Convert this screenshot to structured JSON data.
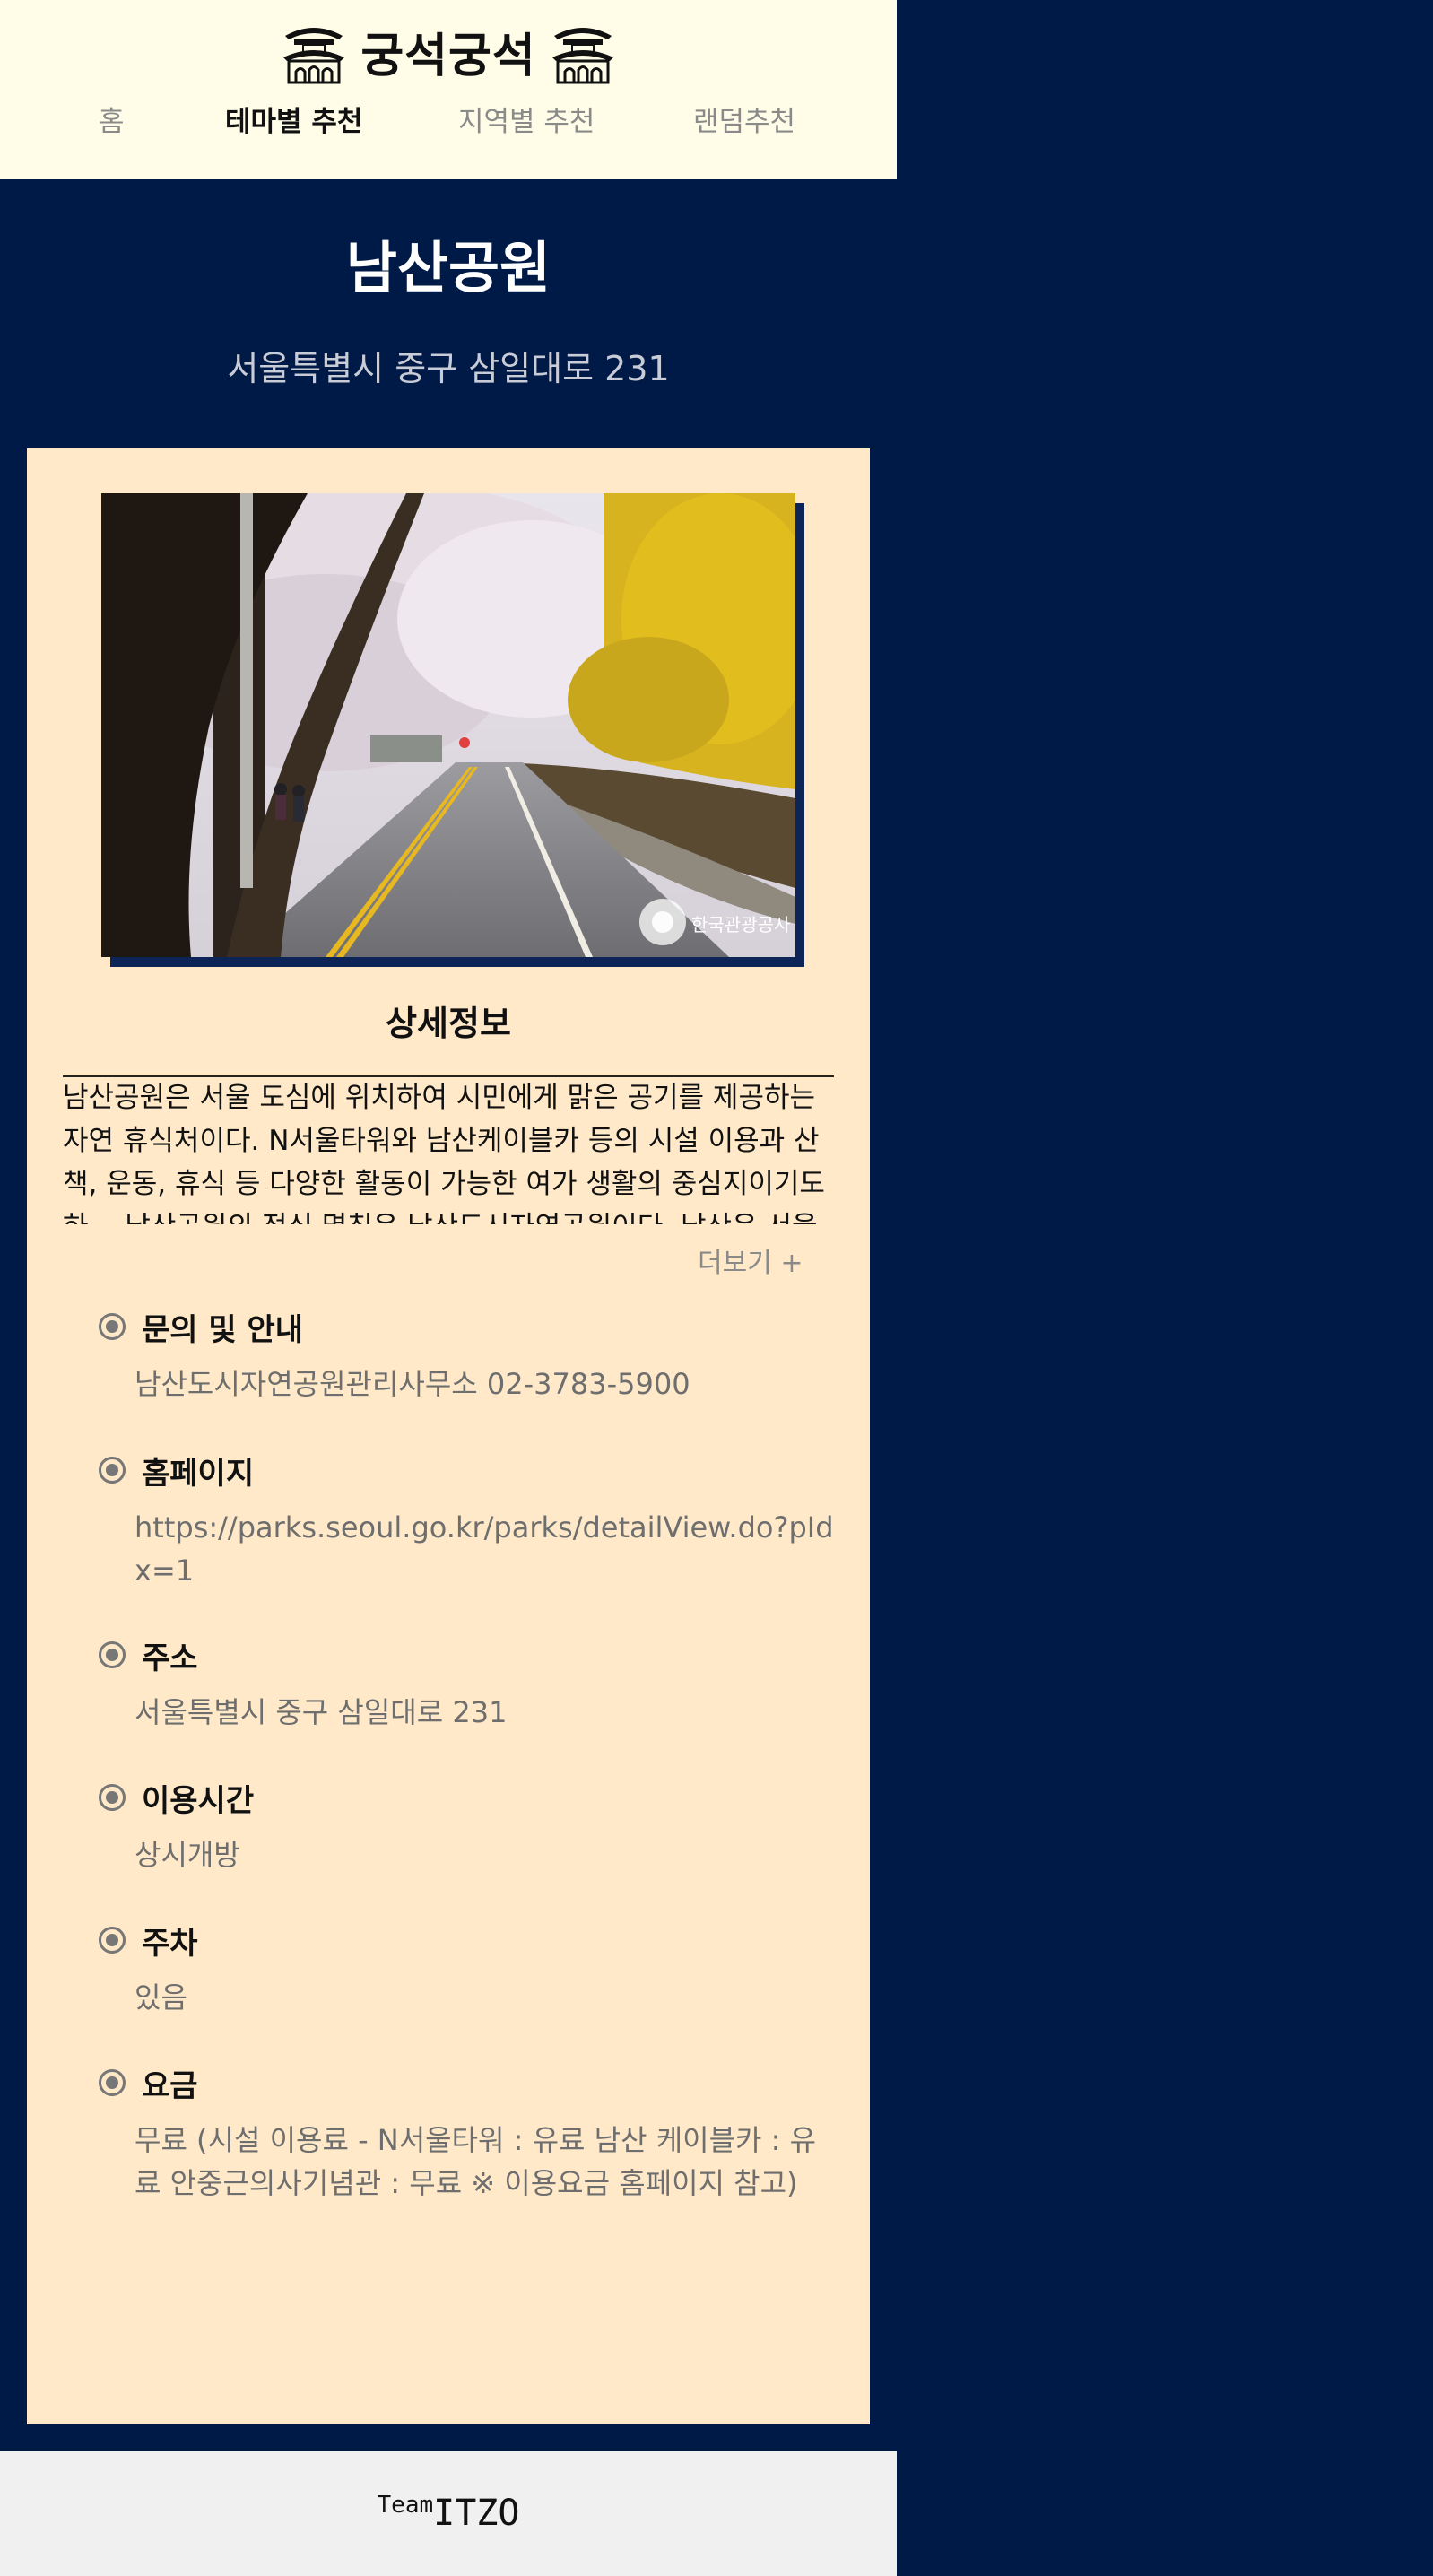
{
  "header": {
    "brand": "궁석궁석",
    "gate_icon": "palace-gate-icon",
    "nav": [
      {
        "label": "홈",
        "active": false
      },
      {
        "label": "테마별 추천",
        "active": true
      },
      {
        "label": "지역별 추천",
        "active": false
      },
      {
        "label": "랜덤추천",
        "active": false
      }
    ]
  },
  "place": {
    "title": "남산공원",
    "address": "서울특별시 중구 삼일대로 231",
    "photo_watermark": "한국관광공사"
  },
  "detail": {
    "heading": "상세정보",
    "overview": "남산공원은 서울 도심에 위치하여 시민에게 맑은 공기를 제공하는 자연 휴식처이다. N서울타워와 남산케이블카 등의 시설 이용과 산책, 운동, 휴식 등 다양한 활동이 가능한 여가 생활의 중심지이기도 하… 남산공원의 정식 명칭은 남산도시자연공원이다. 남산은 서울의 중심",
    "more_label": "더보기 +"
  },
  "info": [
    {
      "label": "문의 및 안내",
      "value": "남산도시자연공원관리사무소 02-3783-5900"
    },
    {
      "label": "홈페이지",
      "value": "https://parks.seoul.go.kr/parks/detailView.do?pIdx=1"
    },
    {
      "label": "주소",
      "value": "서울특별시 중구 삼일대로 231"
    },
    {
      "label": "이용시간",
      "value": "상시개방"
    },
    {
      "label": "주차",
      "value": "있음"
    },
    {
      "label": "요금",
      "value": "무료 (시설 이용료 - N서울타워 : 유료 남산 케이블카 : 유료 안중근의사기념관 : 무료 ※ 이용요금 홈페이지 참고)"
    }
  ],
  "footer": {
    "small": "Team",
    "large": "ITZO"
  },
  "colors": {
    "page_bg": "#001a47",
    "header_bg": "#fffde8",
    "card_bg": "#ffe9c8",
    "footer_bg": "#f0f0f0"
  }
}
